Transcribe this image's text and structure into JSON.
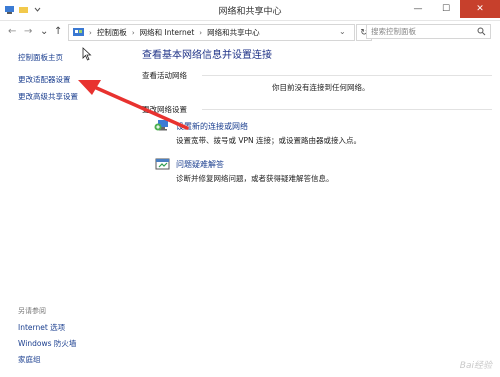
{
  "window": {
    "title": "网络和共享中心",
    "minimize": "—",
    "maximize": "☐",
    "close": "✕"
  },
  "nav": {
    "back": "←",
    "forward": "→",
    "up": "↑",
    "breadcrumb": [
      "控制面板",
      "网络和 Internet",
      "网络和共享中心"
    ],
    "refresh": "↻",
    "search_placeholder": "搜索控制面板"
  },
  "sidebar": {
    "links": [
      "控制面板主页",
      "更改适配器设置",
      "更改高级共享设置"
    ],
    "see_also_heading": "另请参阅",
    "see_also": [
      "Internet 选项",
      "Windows 防火墙",
      "家庭组"
    ]
  },
  "main": {
    "heading": "查看基本网络信息并设置连接",
    "active_networks_label": "查看活动网络",
    "no_network_status": "你目前没有连接到任何网络。",
    "change_settings_label": "更改网络设置",
    "tasks": [
      {
        "link": "设置新的连接或网络",
        "desc": "设置宽带、拨号或 VPN 连接；或设置路由器或接入点。",
        "icon": "network-setup-icon"
      },
      {
        "link": "问题疑难解答",
        "desc": "诊断并修复网络问题，或者获得疑难解答信息。",
        "icon": "troubleshoot-icon"
      }
    ]
  },
  "watermark": "Bai经验",
  "colors": {
    "link": "#1a3e8f",
    "heading": "#1e3287",
    "close": "#c7402c",
    "arrow": "#e8322f"
  }
}
